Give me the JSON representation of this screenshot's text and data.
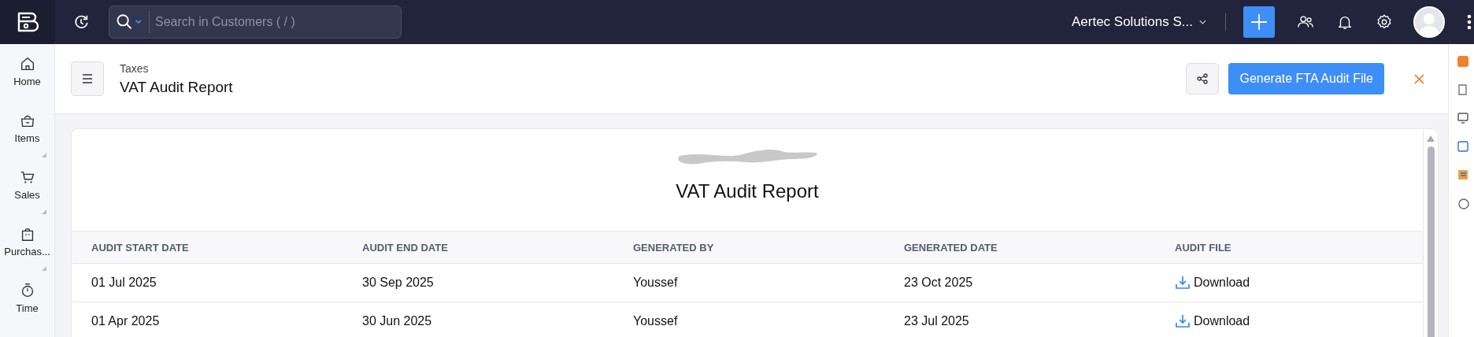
{
  "topbar": {
    "search": {
      "placeholder": "Search in Customers ( / )"
    },
    "organization": "Aertec Solutions S..."
  },
  "sidebar": {
    "items": [
      {
        "label": "Home",
        "kind": "home",
        "expandable": false
      },
      {
        "label": "Items",
        "kind": "items",
        "expandable": true
      },
      {
        "label": "Sales",
        "kind": "sales",
        "expandable": true
      },
      {
        "label": "Purchas...",
        "kind": "purchases",
        "expandable": true
      },
      {
        "label": "Time",
        "kind": "time",
        "expandable": false
      }
    ]
  },
  "header": {
    "breadcrumb": "Taxes",
    "title": "VAT Audit Report",
    "primary_button": "Generate FTA Audit File"
  },
  "report": {
    "title": "VAT Audit Report",
    "table": {
      "columns": [
        "AUDIT START DATE",
        "AUDIT END DATE",
        "GENERATED BY",
        "GENERATED DATE",
        "AUDIT FILE"
      ],
      "rows": [
        {
          "cells": [
            "01 Jul 2025",
            "30 Sep 2025",
            "Youssef",
            "23 Oct 2025"
          ],
          "link": "Download"
        },
        {
          "cells": [
            "01 Apr 2025",
            "30 Jun 2025",
            "Youssef",
            "23 Jul 2025"
          ],
          "link": "Download"
        }
      ]
    }
  }
}
